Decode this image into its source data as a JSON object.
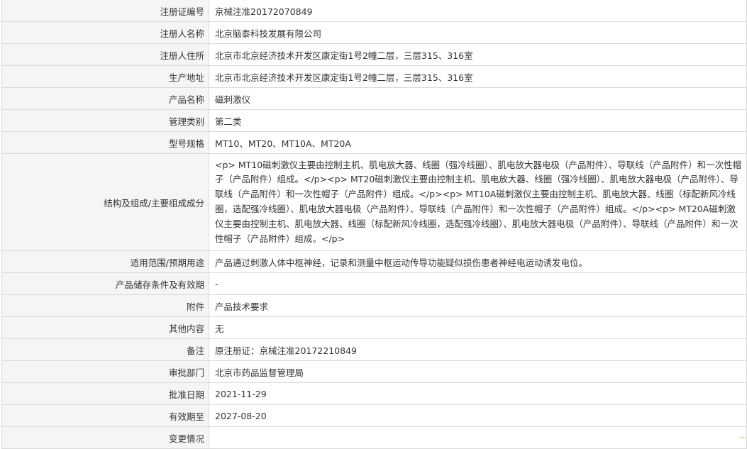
{
  "rows": [
    {
      "label": "注册证编号",
      "value": "京械注准20172070849"
    },
    {
      "label": "注册人名称",
      "value": "北京脑泰科技发展有限公司"
    },
    {
      "label": "注册人住所",
      "value": "北京市北京经济技术开发区康定街1号2幢二层，三层315、316室"
    },
    {
      "label": "生产地址",
      "value": "北京市北京经济技术开发区康定街1号2幢二层，三层315、316室"
    },
    {
      "label": "产品名称",
      "value": "磁刺激仪"
    },
    {
      "label": "管理类别",
      "value": "第二类"
    },
    {
      "label": "型号规格",
      "value": "MT10、MT20、MT10A、MT20A"
    },
    {
      "label": "结构及组成/主要组成成分",
      "value": "<p> MT10磁刺激仪主要由控制主机、肌电放大器、线圈（强冷线圈）、肌电放大器电极（产品附件）、导联线（产品附件）和一次性帽子（产品附件）组成。</p><p> MT20磁刺激仪主要由控制主机、肌电放大器、线圈（强冷线圈）、肌电放大器电极（产品附件）、导联线（产品附件）和一次性帽子（产品附件）组成。</p><p> MT10A磁刺激仪主要由控制主机、肌电放大器、线圈（标配新风冷线圈，选配强冷线圈）、肌电放大器电极（产品附件）、导联线（产品附件）和一次性帽子（产品附件）组成。</p><p> MT20A磁刺激仪主要由控制主机、肌电放大器、线圈（标配新风冷线圈，选配强冷线圈）、肌电放大器电极（产品附件）、导联线（产品附件）和一次性帽子（产品附件）组成。</p>"
    },
    {
      "label": "适用范围/预期用途",
      "value": "产品通过刺激人体中枢神经，记录和测量中枢运动传导功能疑似损伤患者神经电运动诱发电位。"
    },
    {
      "label": "产品储存条件及有效期",
      "value": "-"
    },
    {
      "label": "附件",
      "value": "产品技术要求"
    },
    {
      "label": "其他内容",
      "value": "无"
    },
    {
      "label": "备注",
      "value": "原注册证：京械注准20172210849"
    },
    {
      "label": "审批部门",
      "value": "北京市药品监督管理局"
    },
    {
      "label": "批准日期",
      "value": "2021-11-29"
    },
    {
      "label": "有效期至",
      "value": "2027-08-20"
    },
    {
      "label": "变更情况",
      "value": ""
    }
  ]
}
